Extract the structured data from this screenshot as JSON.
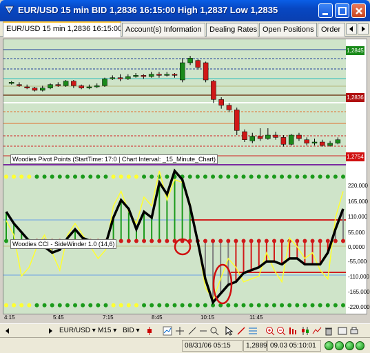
{
  "window": {
    "title": "EUR/USD 15 min BID 1,2836 16:15:00 High 1,2837 Low 1,2835",
    "min_icon": "minimize-icon",
    "max_icon": "maximize-icon",
    "close_icon": "close-icon"
  },
  "tabs": [
    {
      "label": "EUR/USD 15 min 1,2836 16:15:00",
      "active": true
    },
    {
      "label": "Account(s) Information",
      "active": false
    },
    {
      "label": "Dealing Rates",
      "active": false
    },
    {
      "label": "Open Positions",
      "active": false
    },
    {
      "label": "Order",
      "active": false
    }
  ],
  "price_panel": {
    "price_tags": [
      {
        "label": "1,2845",
        "color": "#1a8a1a"
      },
      {
        "label": "1,2836",
        "color": "#b01010"
      },
      {
        "label": "1,2754",
        "color": "#d01010"
      }
    ],
    "legend": "Woodies Pivot Points (StartTime: 17:0 | Chart Interval: _15_Minute_Chart)"
  },
  "cci_panel": {
    "legend": "Woodies CCI - SideWinder 1.0 (14,6)",
    "axis_labels": [
      "220,000",
      "165,000",
      "110,000",
      "55,000",
      "0,0000",
      "-55,000",
      "-110,000",
      "-165,000",
      "-220,000"
    ]
  },
  "time_axis": [
    "4:15",
    "5:45",
    "7:15",
    "8:45",
    "10:15",
    "11:45"
  ],
  "toolbar": {
    "symbol": "EUR/USD",
    "timeframe": "M15",
    "price_type": "BID"
  },
  "statusbar": {
    "left_time": "08/31/06 05:15",
    "left_price": "1,2889",
    "right_time": "09.03 05:10:01"
  },
  "chart_data": {
    "type": "candlestick",
    "price_ylim": [
      1.2745,
      1.285
    ],
    "candles": [
      {
        "o": 1.2814,
        "c": 1.2815,
        "h": 1.2816,
        "l": 1.2813,
        "up": true
      },
      {
        "o": 1.2813,
        "c": 1.2812,
        "h": 1.2815,
        "l": 1.2811,
        "up": false
      },
      {
        "o": 1.2811,
        "c": 1.281,
        "h": 1.2813,
        "l": 1.2809,
        "up": false
      },
      {
        "o": 1.281,
        "c": 1.2808,
        "h": 1.2811,
        "l": 1.2807,
        "up": false
      },
      {
        "o": 1.2808,
        "c": 1.281,
        "h": 1.2812,
        "l": 1.2807,
        "up": true
      },
      {
        "o": 1.281,
        "c": 1.2813,
        "h": 1.2814,
        "l": 1.2809,
        "up": true
      },
      {
        "o": 1.2813,
        "c": 1.2812,
        "h": 1.2815,
        "l": 1.2811,
        "up": false
      },
      {
        "o": 1.2812,
        "c": 1.2816,
        "h": 1.2817,
        "l": 1.2811,
        "up": true
      },
      {
        "o": 1.2816,
        "c": 1.2812,
        "h": 1.2817,
        "l": 1.281,
        "up": false
      },
      {
        "o": 1.2812,
        "c": 1.281,
        "h": 1.2813,
        "l": 1.2809,
        "up": false
      },
      {
        "o": 1.281,
        "c": 1.2811,
        "h": 1.2813,
        "l": 1.2809,
        "up": true
      },
      {
        "o": 1.2811,
        "c": 1.2812,
        "h": 1.2814,
        "l": 1.281,
        "up": true
      },
      {
        "o": 1.2812,
        "c": 1.2818,
        "h": 1.2819,
        "l": 1.2811,
        "up": true
      },
      {
        "o": 1.2818,
        "c": 1.2819,
        "h": 1.2821,
        "l": 1.2817,
        "up": true
      },
      {
        "o": 1.2819,
        "c": 1.2818,
        "h": 1.2822,
        "l": 1.2816,
        "up": false
      },
      {
        "o": 1.2818,
        "c": 1.282,
        "h": 1.2822,
        "l": 1.2817,
        "up": true
      },
      {
        "o": 1.282,
        "c": 1.2821,
        "h": 1.2823,
        "l": 1.2819,
        "up": true
      },
      {
        "o": 1.2821,
        "c": 1.282,
        "h": 1.2822,
        "l": 1.2818,
        "up": false
      },
      {
        "o": 1.282,
        "c": 1.2822,
        "h": 1.2824,
        "l": 1.2819,
        "up": true
      },
      {
        "o": 1.2822,
        "c": 1.2821,
        "h": 1.2824,
        "l": 1.2819,
        "up": false
      },
      {
        "o": 1.2821,
        "c": 1.2822,
        "h": 1.2824,
        "l": 1.282,
        "up": true
      },
      {
        "o": 1.2822,
        "c": 1.2821,
        "h": 1.2823,
        "l": 1.2819,
        "up": false
      },
      {
        "o": 1.2817,
        "c": 1.2832,
        "h": 1.2836,
        "l": 1.2815,
        "up": true
      },
      {
        "o": 1.2832,
        "c": 1.2836,
        "h": 1.2838,
        "l": 1.283,
        "up": true
      },
      {
        "o": 1.2834,
        "c": 1.2828,
        "h": 1.2835,
        "l": 1.2826,
        "up": false
      },
      {
        "o": 1.2832,
        "c": 1.2817,
        "h": 1.2833,
        "l": 1.2815,
        "up": false
      },
      {
        "o": 1.2816,
        "c": 1.28,
        "h": 1.2817,
        "l": 1.2797,
        "up": false
      },
      {
        "o": 1.28,
        "c": 1.2795,
        "h": 1.2802,
        "l": 1.2792,
        "up": false
      },
      {
        "o": 1.2795,
        "c": 1.2791,
        "h": 1.2797,
        "l": 1.2789,
        "up": false
      },
      {
        "o": 1.2791,
        "c": 1.2773,
        "h": 1.2793,
        "l": 1.2769,
        "up": false
      },
      {
        "o": 1.2772,
        "c": 1.2765,
        "h": 1.2774,
        "l": 1.2763,
        "up": false
      },
      {
        "o": 1.2764,
        "c": 1.2768,
        "h": 1.2771,
        "l": 1.2762,
        "up": true
      },
      {
        "o": 1.2768,
        "c": 1.2766,
        "h": 1.2775,
        "l": 1.2764,
        "up": false
      },
      {
        "o": 1.2766,
        "c": 1.2769,
        "h": 1.2775,
        "l": 1.2765,
        "up": true
      },
      {
        "o": 1.2769,
        "c": 1.2767,
        "h": 1.2772,
        "l": 1.2765,
        "up": false
      },
      {
        "o": 1.2767,
        "c": 1.2761,
        "h": 1.2769,
        "l": 1.2759,
        "up": false
      },
      {
        "o": 1.2761,
        "c": 1.2769,
        "h": 1.277,
        "l": 1.276,
        "up": true
      },
      {
        "o": 1.2769,
        "c": 1.2766,
        "h": 1.2771,
        "l": 1.2764,
        "up": false
      },
      {
        "o": 1.2765,
        "c": 1.2762,
        "h": 1.2767,
        "l": 1.276,
        "up": false
      },
      {
        "o": 1.2762,
        "c": 1.2763,
        "h": 1.2766,
        "l": 1.276,
        "up": true
      },
      {
        "o": 1.2763,
        "c": 1.276,
        "h": 1.2765,
        "l": 1.2759,
        "up": false
      },
      {
        "o": 1.276,
        "c": 1.2762,
        "h": 1.2764,
        "l": 1.2759,
        "up": true
      },
      {
        "o": 1.2762,
        "c": 1.2765,
        "h": 1.2767,
        "l": 1.2761,
        "up": true
      }
    ],
    "cci_ylim": [
      -230,
      230
    ],
    "cci": [
      100,
      60,
      30,
      0,
      -10,
      -20,
      -40,
      -30,
      10,
      40,
      10,
      0,
      -10,
      -10,
      80,
      140,
      110,
      40,
      100,
      80,
      200,
      160,
      240,
      210,
      120,
      0,
      -130,
      -210,
      -180,
      -150,
      -140,
      -110,
      -100,
      -90,
      -70,
      -70,
      -80,
      -60,
      -60,
      -80,
      -80,
      -80,
      -40,
      40,
      110
    ],
    "turbo_cci": [
      70,
      20,
      -120,
      -90,
      -20,
      20,
      -40,
      -100,
      20,
      60,
      20,
      -20,
      -60,
      -30,
      120,
      170,
      100,
      60,
      150,
      120,
      240,
      140,
      210,
      200,
      130,
      0,
      -160,
      -200,
      -130,
      -60,
      -90,
      -140,
      -130,
      -120,
      -40,
      -100,
      -140,
      10,
      -20,
      -60,
      -40,
      -100,
      -130,
      80,
      170
    ]
  }
}
